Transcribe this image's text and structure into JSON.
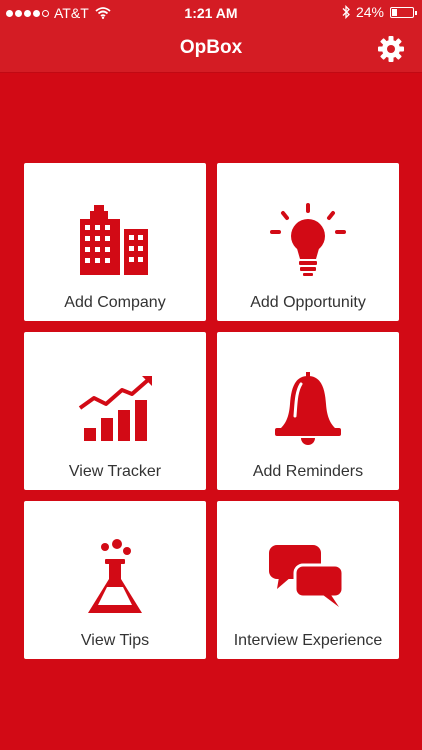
{
  "status": {
    "carrier": "AT&T",
    "time": "1:21 AM",
    "battery_text": "24%",
    "battery_level": 0.24,
    "signal_bars": 4
  },
  "app": {
    "title": "OpBox"
  },
  "icons": {
    "settings": "gear-icon",
    "bluetooth": "bluetooth-icon",
    "wifi": "wifi-icon"
  },
  "colors": {
    "accent": "#d20a15",
    "tile": "#ffffff",
    "icon": "#d20a15",
    "text": "#333333"
  },
  "tiles": [
    {
      "label": "Add Company",
      "icon": "buildings-icon"
    },
    {
      "label": "Add Opportunity",
      "icon": "lightbulb-icon"
    },
    {
      "label": "View Tracker",
      "icon": "chart-trend-icon"
    },
    {
      "label": "Add Reminders",
      "icon": "bell-icon"
    },
    {
      "label": "View Tips",
      "icon": "flask-icon"
    },
    {
      "label": "Interview Experience",
      "icon": "chat-bubbles-icon"
    }
  ]
}
